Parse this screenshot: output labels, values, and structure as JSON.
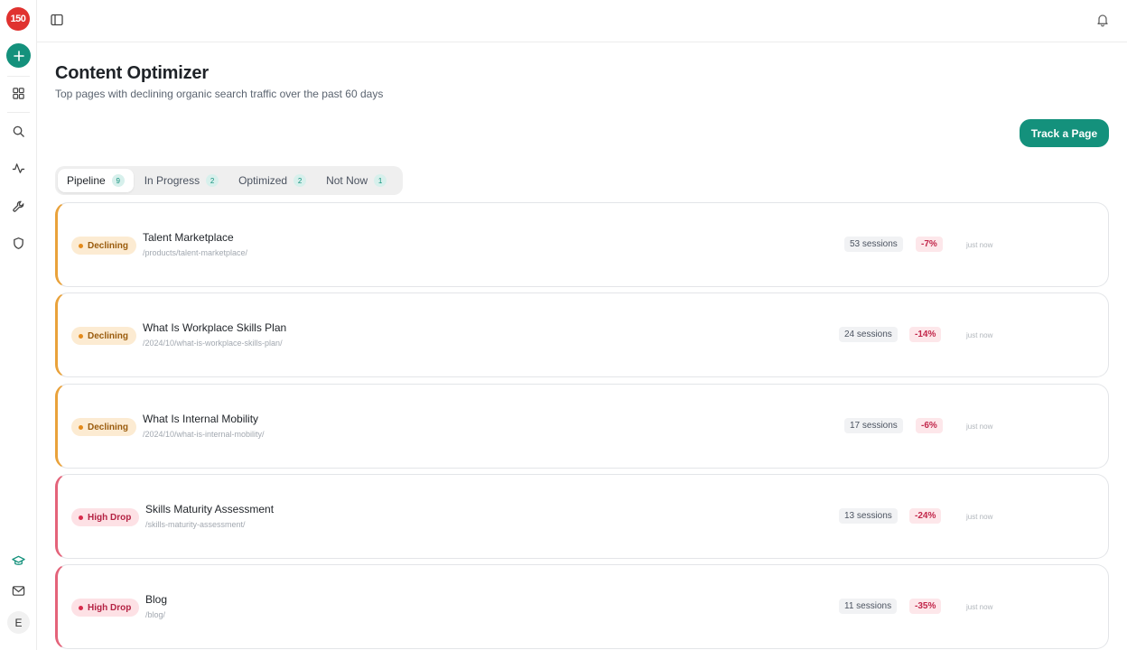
{
  "app": {
    "logo_text": "150"
  },
  "sidebar": {
    "nav": [
      {
        "name": "dashboard-icon"
      },
      {
        "name": "search-icon"
      },
      {
        "name": "activity-icon"
      },
      {
        "name": "wrench-icon"
      },
      {
        "name": "shield-icon"
      }
    ],
    "bottom": [
      {
        "name": "graduation-cap-icon"
      },
      {
        "name": "mail-icon"
      }
    ],
    "avatar_initial": "E"
  },
  "header": {
    "title": "Content Optimizer",
    "subtitle": "Top pages with declining organic search traffic over the past 60 days",
    "track_button": "Track a Page"
  },
  "tabs": [
    {
      "label": "Pipeline",
      "count": "9",
      "active": true
    },
    {
      "label": "In Progress",
      "count": "2",
      "active": false
    },
    {
      "label": "Optimized",
      "count": "2",
      "active": false
    },
    {
      "label": "Not Now",
      "count": "1",
      "active": false
    }
  ],
  "colors": {
    "accent": "#14917c",
    "declining": "#e9a23b",
    "high_drop": "#e4637a"
  },
  "pages": [
    {
      "status": "Declining",
      "title": "Talent Marketplace",
      "path": "/products/talent-marketplace/",
      "sessions": "53 sessions",
      "change": "-7%",
      "updated": "just now"
    },
    {
      "status": "Declining",
      "title": "What Is Workplace Skills Plan",
      "path": "/2024/10/what-is-workplace-skills-plan/",
      "sessions": "24 sessions",
      "change": "-14%",
      "updated": "just now"
    },
    {
      "status": "Declining",
      "title": "What Is Internal Mobility",
      "path": "/2024/10/what-is-internal-mobility/",
      "sessions": "17 sessions",
      "change": "-6%",
      "updated": "just now"
    },
    {
      "status": "High Drop",
      "title": "Skills Maturity Assessment",
      "path": "/skills-maturity-assessment/",
      "sessions": "13 sessions",
      "change": "-24%",
      "updated": "just now"
    },
    {
      "status": "High Drop",
      "title": "Blog",
      "path": "/blog/",
      "sessions": "11 sessions",
      "change": "-35%",
      "updated": "just now"
    }
  ]
}
